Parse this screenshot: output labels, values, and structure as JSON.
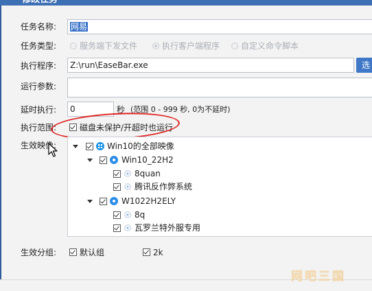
{
  "dialog": {
    "title": "修改任务"
  },
  "form": {
    "task_name_label": "任务名称:",
    "task_name_value": "网易",
    "task_type_label": "任务类型:",
    "task_types": [
      {
        "label": "服务端下发文件",
        "selected": false
      },
      {
        "label": "执行客户端程序",
        "selected": true
      },
      {
        "label": "自定义命令脚本",
        "selected": false
      }
    ],
    "program_label": "执行程序:",
    "program_value": "Z:\\run\\EaseBar.exe",
    "browse_button": "选",
    "params_label": "运行参数:",
    "params_value": "",
    "delay_label": "延时执行:",
    "delay_value": "0",
    "delay_unit": "秒",
    "delay_hint": "(范围 0 - 999 秒, 0为不延时)",
    "scope_label": "执行范围:",
    "scope_option": "磁盘未保护/开超时也运行",
    "scope_checked": true,
    "images_label": "生效映像:",
    "groups_label": "生效分组:",
    "groups": [
      {
        "label": "默认组",
        "checked": true
      },
      {
        "label": "2k",
        "checked": true
      }
    ]
  },
  "tree": {
    "root": {
      "label": "Win10的全部映像",
      "checked": true,
      "icon": "windows-icon"
    },
    "images": [
      {
        "label": "Win10_22H2",
        "checked": true,
        "icon": "image-disc-icon",
        "children": [
          {
            "label": "8quan",
            "checked": true,
            "icon": "computer-dot-icon"
          },
          {
            "label": "腾讯反作弊系统",
            "checked": true,
            "icon": "computer-dot-icon"
          }
        ]
      },
      {
        "label": "W1022H2ELY",
        "checked": true,
        "icon": "image-disc-icon",
        "children": [
          {
            "label": "8q",
            "checked": true,
            "icon": "computer-dot-icon"
          },
          {
            "label": "瓦罗兰特外服专用",
            "checked": true,
            "icon": "computer-dot-icon"
          }
        ]
      }
    ]
  },
  "watermark": "网吧三国",
  "colors": {
    "selection": "#3b73c9",
    "annotation_circle": "#e02020",
    "tree_icon_blue": "#2c8de6",
    "watermark": "#f5d7a6"
  }
}
